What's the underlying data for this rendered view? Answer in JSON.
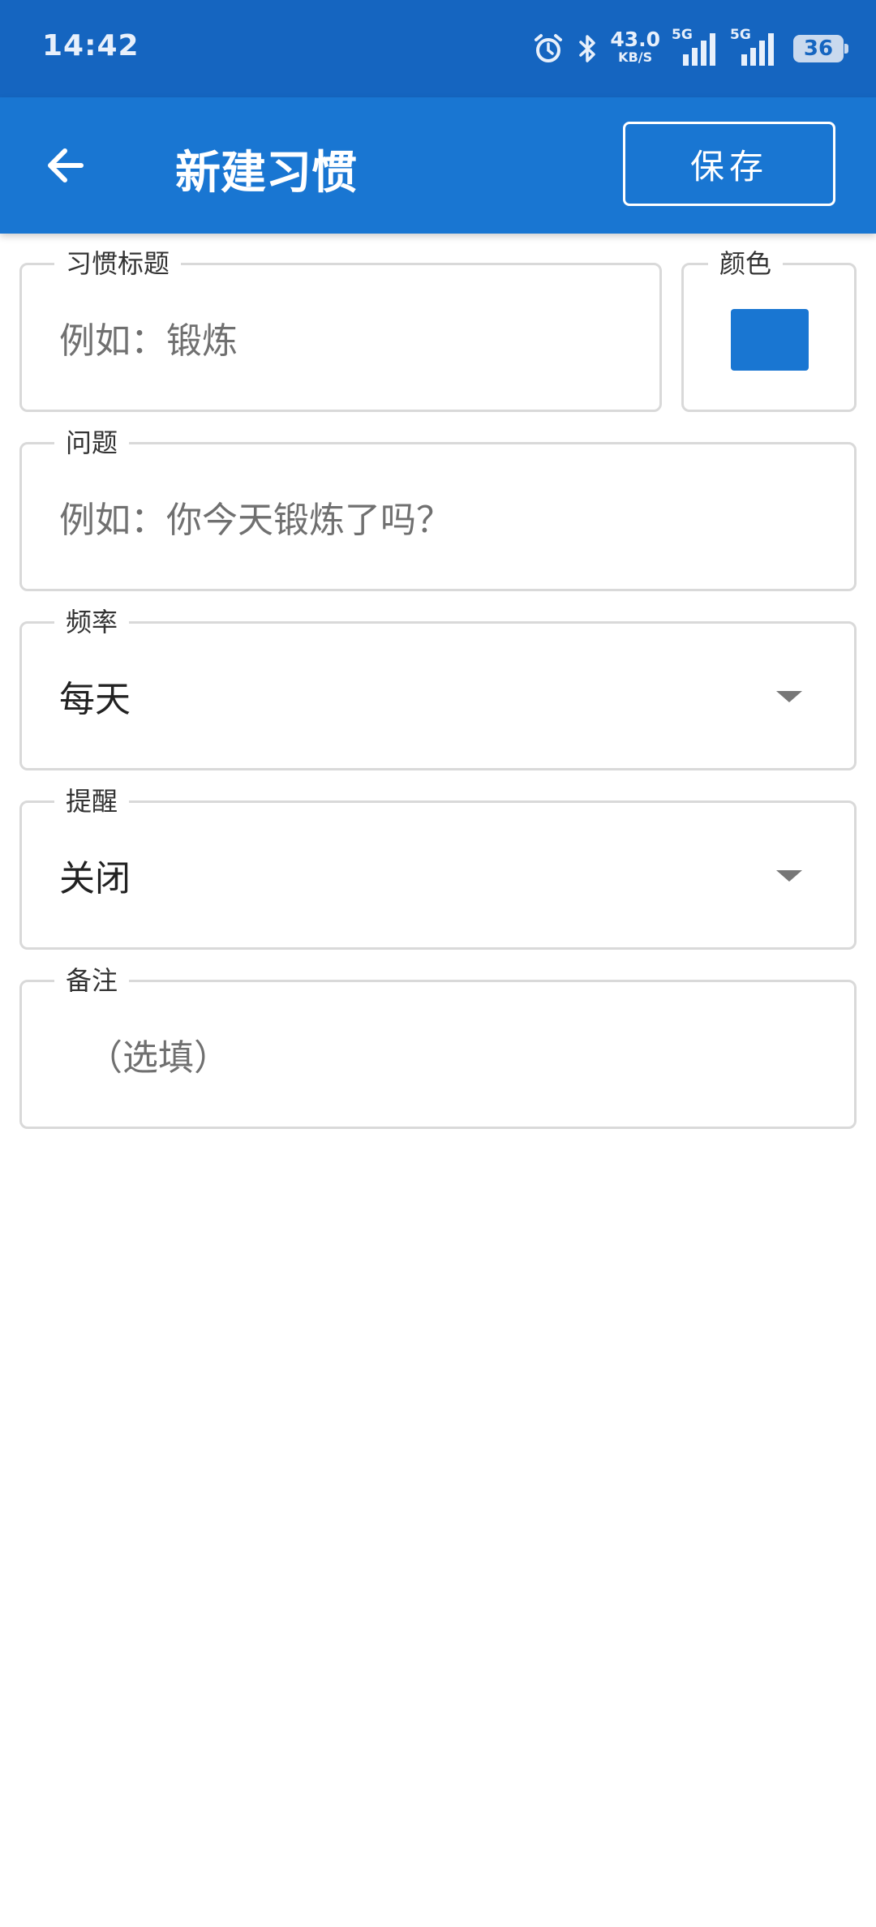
{
  "status_bar": {
    "time": "14:42",
    "net_speed_value": "43.0",
    "net_speed_unit": "KB/S",
    "sim1_label": "5G",
    "sim2_label": "5G",
    "battery": "36",
    "icons": [
      "alarm-icon",
      "bluetooth-icon",
      "signal-icon",
      "signal-icon",
      "battery-icon"
    ]
  },
  "app_bar": {
    "title": "新建习惯",
    "save_label": "保存",
    "back_icon": "arrow-left-icon"
  },
  "form": {
    "habit_title": {
      "label": "习惯标题",
      "placeholder": "例如：锻炼"
    },
    "color": {
      "label": "颜色",
      "value": "#1976d2"
    },
    "question": {
      "label": "问题",
      "placeholder": "例如：你今天锻炼了吗？"
    },
    "frequency": {
      "label": "频率",
      "value": "每天"
    },
    "reminder": {
      "label": "提醒",
      "value": "关闭"
    },
    "notes": {
      "label": "备注",
      "placeholder": "（选填）"
    }
  },
  "colors": {
    "status_bar": "#1565c0",
    "app_bar": "#1976d2",
    "accent": "#1976d2",
    "field_border": "#d9d9d9"
  }
}
